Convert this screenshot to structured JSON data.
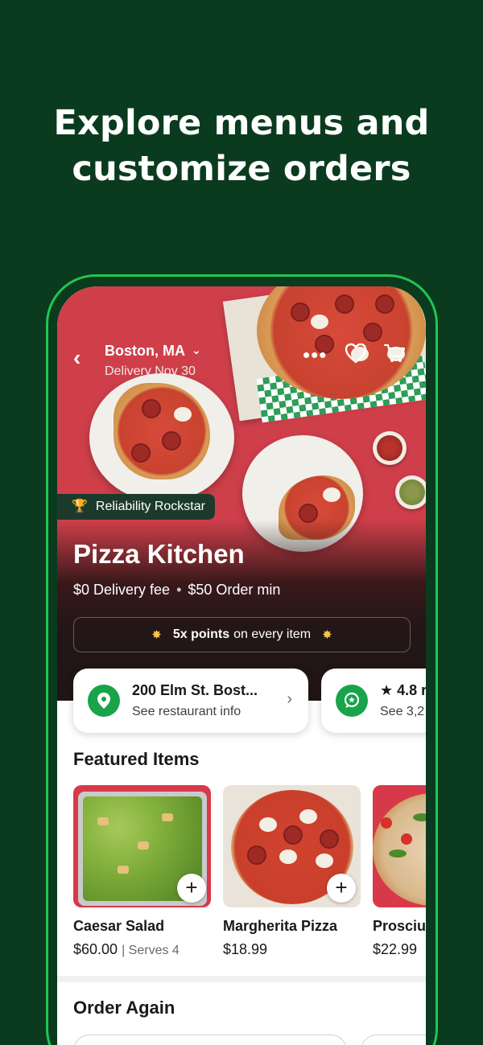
{
  "headline": {
    "line1": "Explore menus and",
    "line2": "customize orders"
  },
  "colors": {
    "background": "#0a3b1f",
    "frame_accent": "#22c552",
    "brand_green": "#19a34a",
    "hero_red": "#cf3f4a"
  },
  "topbar": {
    "back_icon": "chevron-left-icon",
    "location": "Boston, MA",
    "delivery": "Delivery Nov 30",
    "more_icon": "more-horizontal-icon",
    "favorite_icon": "heart-icon",
    "cart_icon": "cart-icon"
  },
  "store": {
    "badge": "Reliability Rockstar",
    "name": "Pizza Kitchen",
    "delivery_fee": "$0 Delivery fee",
    "separator": "•",
    "order_min": "$50 Order min",
    "points_bold": "5x points",
    "points_rest": "on every item"
  },
  "info_cards": [
    {
      "title": "200 Elm St. Bost...",
      "subtitle": "See restaurant info",
      "icon": "location-pin-icon"
    },
    {
      "title": "★ 4.8 r",
      "subtitle": "See 3,2",
      "icon": "review-bubble-icon"
    }
  ],
  "featured": {
    "title": "Featured Items",
    "items": [
      {
        "name": "Caesar Salad",
        "price": "$60.00",
        "serves": "| Serves 4"
      },
      {
        "name": "Margherita Pizza",
        "price": "$18.99"
      },
      {
        "name": "Prosciu",
        "price": "$22.99"
      }
    ],
    "add_label": "+"
  },
  "order_again": {
    "title": "Order Again"
  }
}
